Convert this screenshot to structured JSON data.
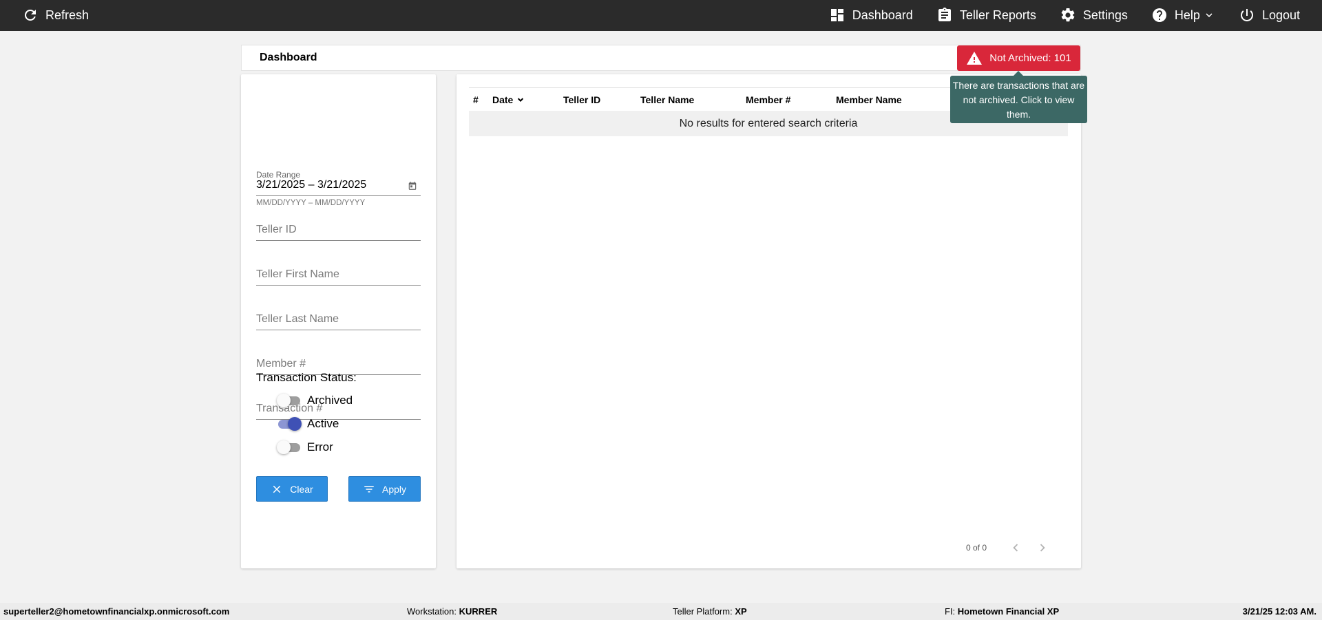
{
  "topbar": {
    "refresh_label": "Refresh",
    "nav": {
      "dashboard": "Dashboard",
      "teller_reports": "Teller Reports",
      "settings": "Settings",
      "help": "Help",
      "logout": "Logout"
    }
  },
  "page": {
    "title": "Dashboard",
    "alert_label": "Not Archived: 101",
    "alert_tooltip": "There are transactions that are not archived. Click to view them."
  },
  "filters": {
    "date_range_label": "Date Range",
    "date_range_value": "3/21/2025 – 3/21/2025",
    "date_hint": "MM/DD/YYYY – MM/DD/YYYY",
    "teller_id_placeholder": "Teller ID",
    "teller_first_name_placeholder": "Teller First Name",
    "teller_last_name_placeholder": "Teller Last Name",
    "member_number_placeholder": "Member #",
    "transaction_number_placeholder": "Transaction #",
    "status_label": "Transaction Status:",
    "statuses": [
      {
        "label": "Archived",
        "checked": false
      },
      {
        "label": "Active",
        "checked": true
      },
      {
        "label": "Error",
        "checked": false
      }
    ],
    "clear_label": "Clear",
    "apply_label": "Apply"
  },
  "table": {
    "columns": [
      "#",
      "Date",
      "Teller ID",
      "Teller Name",
      "Member #",
      "Member Name"
    ],
    "empty_message": "No results for entered search criteria",
    "pagination": "0 of 0"
  },
  "footer": {
    "user": "superteller2@hometownfinancialxp.onmicrosoft.com",
    "workstation_label": "Workstation:",
    "workstation_value": "KURRER",
    "platform_label": "Teller Platform:",
    "platform_value": "XP",
    "fi_label": "FI:",
    "fi_value": "Hometown Financial XP",
    "datetime": "3/21/25 12:03 AM."
  },
  "colors": {
    "topbar": "#2b2b2b",
    "alert": "#d9273a",
    "tooltip": "#3c6865",
    "button": "#2e8ee0",
    "toggle_on": "#3f51b5"
  },
  "icons": {
    "refresh": "refresh-icon",
    "dashboard": "dashboard-icon",
    "teller_reports": "clipboard-icon",
    "settings": "gear-icon",
    "help": "help-circle-icon",
    "logout": "power-icon",
    "alert": "warning-icon",
    "calendar": "calendar-icon",
    "clear": "close-icon",
    "apply": "filter-icon"
  }
}
